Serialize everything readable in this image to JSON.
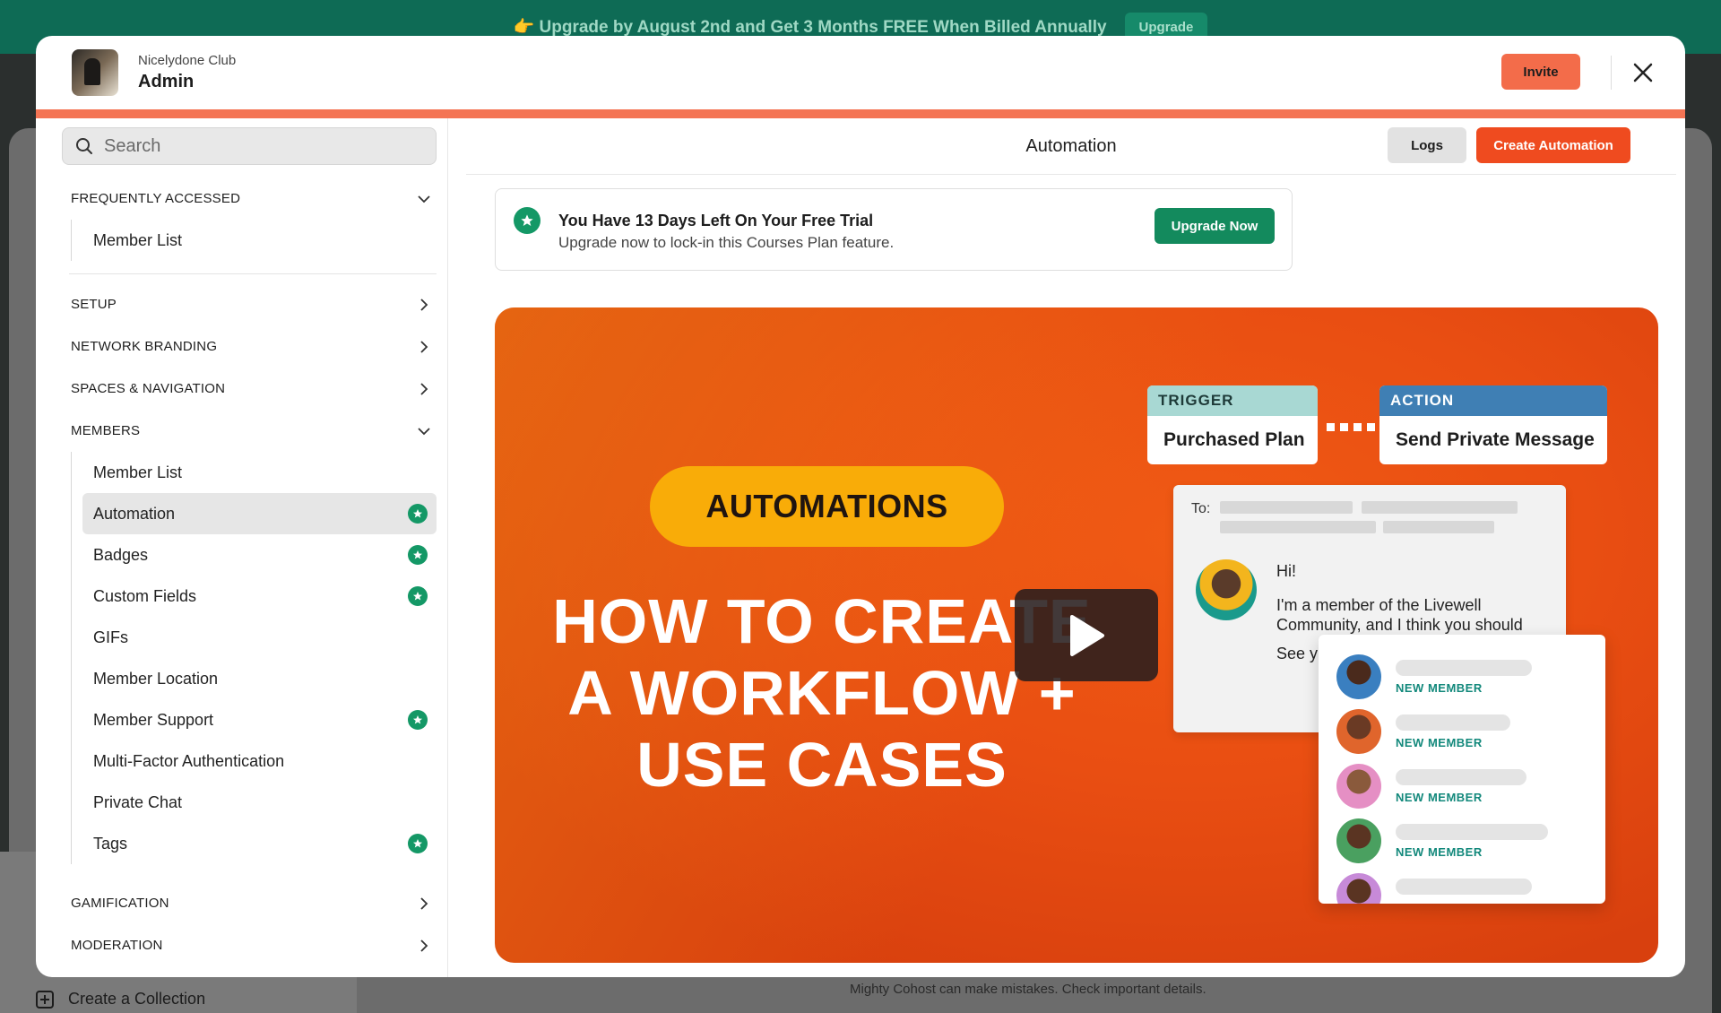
{
  "banner": {
    "text": "👉 Upgrade by August 2nd and Get 3 Months FREE When Billed Annually",
    "button": "Upgrade"
  },
  "background": {
    "create_collection": "Create a Collection",
    "disclaimer": "Mighty Cohost can make mistakes. Check important details."
  },
  "header": {
    "club_name": "Nicelydone Club",
    "role": "Admin",
    "invite": "Invite"
  },
  "search": {
    "placeholder": "Search"
  },
  "sidebar": {
    "frequently_accessed": "FREQUENTLY ACCESSED",
    "frequent_items": [
      "Member List"
    ],
    "setup": "SETUP",
    "network_branding": "NETWORK BRANDING",
    "spaces_navigation": "SPACES & NAVIGATION",
    "members": "MEMBERS",
    "member_items": [
      {
        "label": "Member List",
        "premium": false
      },
      {
        "label": "Automation",
        "premium": true,
        "active": true
      },
      {
        "label": "Badges",
        "premium": true
      },
      {
        "label": "Custom Fields",
        "premium": true
      },
      {
        "label": "GIFs",
        "premium": false
      },
      {
        "label": "Member Location",
        "premium": false
      },
      {
        "label": "Member Support",
        "premium": true
      },
      {
        "label": "Multi-Factor Authentication",
        "premium": false
      },
      {
        "label": "Private Chat",
        "premium": false
      },
      {
        "label": "Tags",
        "premium": true
      }
    ],
    "gamification": "GAMIFICATION",
    "moderation": "MODERATION"
  },
  "main": {
    "title": "Automation",
    "logs": "Logs",
    "create": "Create Automation"
  },
  "trial": {
    "title": "You Have 13 Days Left On Your Free Trial",
    "subtitle": "Upgrade now to lock-in this Courses Plan feature.",
    "button": "Upgrade Now"
  },
  "video": {
    "pill": "AUTOMATIONS",
    "headline_1": "HOW TO CREATE",
    "headline_2": "A WORKFLOW +",
    "headline_3": "USE CASES",
    "trigger_label": "TRIGGER",
    "trigger_value": "Purchased Plan",
    "action_label": "ACTION",
    "action_value": "Send Private Message",
    "to_label": "To:",
    "msg_hi": "Hi!",
    "msg_body": "I'm a member of the Livewell Community, and I think you should",
    "msg_see": "See y",
    "new_member": "NEW MEMBER"
  },
  "colors": {
    "brand_orange": "#f36c4a",
    "create_red": "#ef4b1f",
    "green": "#149866"
  }
}
